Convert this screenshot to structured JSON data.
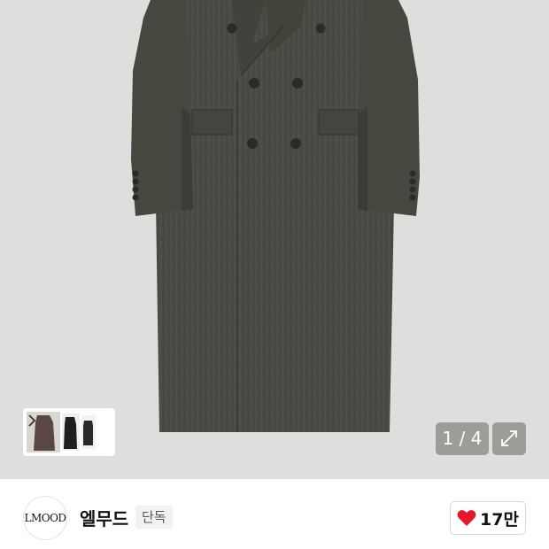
{
  "gallery": {
    "counter": "1 / 4",
    "image_alt": "herringbone double-breasted long coat",
    "thumbnail_next_icon": "chevron-right-icon",
    "expand_icon": "expand-arrows-icon"
  },
  "brand": {
    "logo_text": "LMOOD",
    "name": "엘무드",
    "tag": "단독",
    "likes": "17만",
    "like_icon": "heart-icon",
    "like_color": "#e3182d"
  }
}
